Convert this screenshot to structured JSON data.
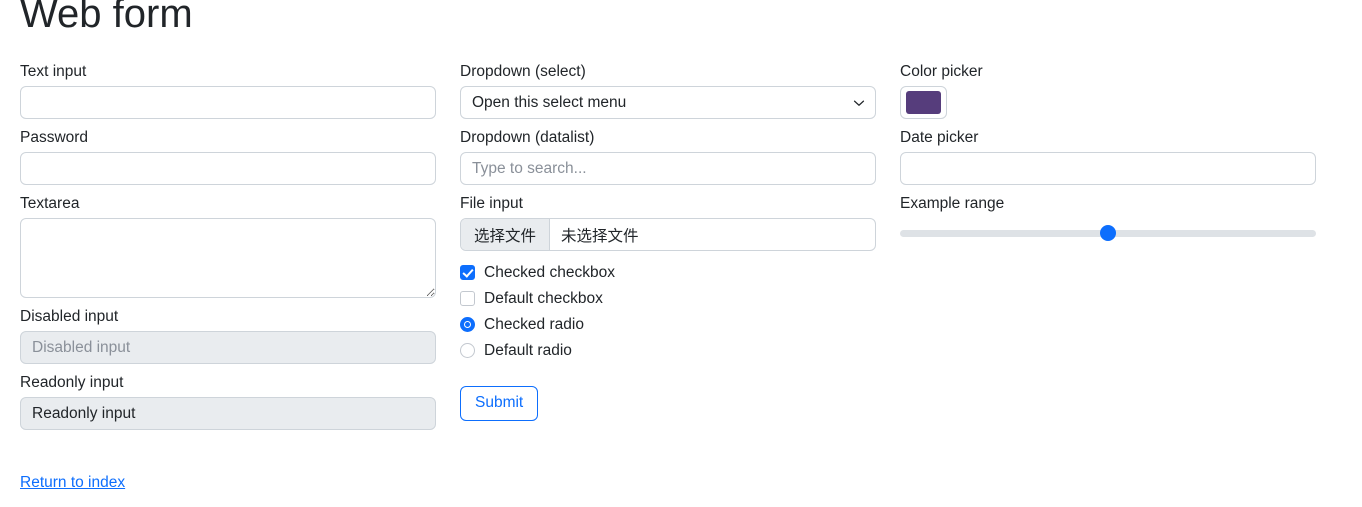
{
  "page": {
    "title": "Web form",
    "return_link": "Return to index"
  },
  "colors": {
    "primary": "#0d6efd",
    "color_picker_value": "#563d7c",
    "border": "#ced4da",
    "disabled_bg": "#e9ecef"
  },
  "left_column": {
    "text_input": {
      "label": "Text input",
      "value": "",
      "placeholder": ""
    },
    "password": {
      "label": "Password",
      "value": "",
      "placeholder": ""
    },
    "textarea": {
      "label": "Textarea",
      "value": "",
      "placeholder": ""
    },
    "disabled_input": {
      "label": "Disabled input",
      "value": "Disabled input"
    },
    "readonly_input": {
      "label": "Readonly input",
      "value": "Readonly input"
    }
  },
  "middle_column": {
    "select": {
      "label": "Dropdown (select)",
      "selected": "Open this select menu",
      "options": [
        "Open this select menu"
      ],
      "caret_icon": "chevron-down-icon"
    },
    "datalist": {
      "label": "Dropdown (datalist)",
      "value": "",
      "placeholder": "Type to search..."
    },
    "file_input": {
      "label": "File input",
      "button_label": "选择文件",
      "status_text": "未选择文件"
    },
    "checks": [
      {
        "type": "checkbox",
        "label": "Checked checkbox",
        "checked": true
      },
      {
        "type": "checkbox",
        "label": "Default checkbox",
        "checked": false
      },
      {
        "type": "radio",
        "label": "Checked radio",
        "checked": true
      },
      {
        "type": "radio",
        "label": "Default radio",
        "checked": false
      }
    ],
    "submit": {
      "label": "Submit"
    }
  },
  "right_column": {
    "color_picker": {
      "label": "Color picker",
      "value": "#563d7c"
    },
    "date_picker": {
      "label": "Date picker",
      "value": "",
      "placeholder": ""
    },
    "range": {
      "label": "Example range",
      "value": 50,
      "min": 0,
      "max": 100
    }
  }
}
